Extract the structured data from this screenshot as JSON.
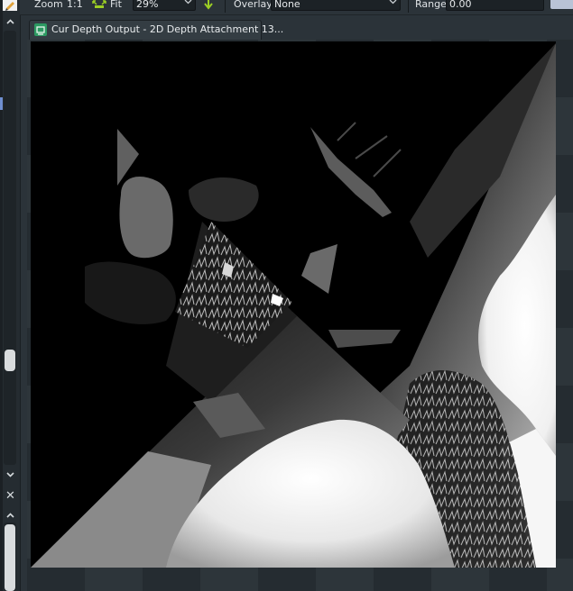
{
  "toolbar": {
    "zoom_label": "Zoom",
    "zoom_1to1": "1:1",
    "fit_label": "Fit",
    "zoom_value": "29%",
    "overlay_label": "Overlay",
    "overlay_value": "None",
    "range_label": "Range",
    "range_value": "0.00"
  },
  "tab": {
    "label": "Cur Depth Output - 2D Depth Attachment 13..."
  },
  "colors": {
    "panel_bg": "#2b3339",
    "accent_green": "#9ccf24",
    "tab_icon": "#2c9a62",
    "selection_blue": "#6f8fd0"
  },
  "icons": {
    "fit": "fit-icon",
    "apply_down": "down-arrow-icon",
    "tab": "texture-icon",
    "close": "close-icon",
    "scroll_up": "chevron-up-icon",
    "scroll_down": "chevron-down-icon"
  },
  "gutter": {
    "close_glyph": "✕"
  }
}
